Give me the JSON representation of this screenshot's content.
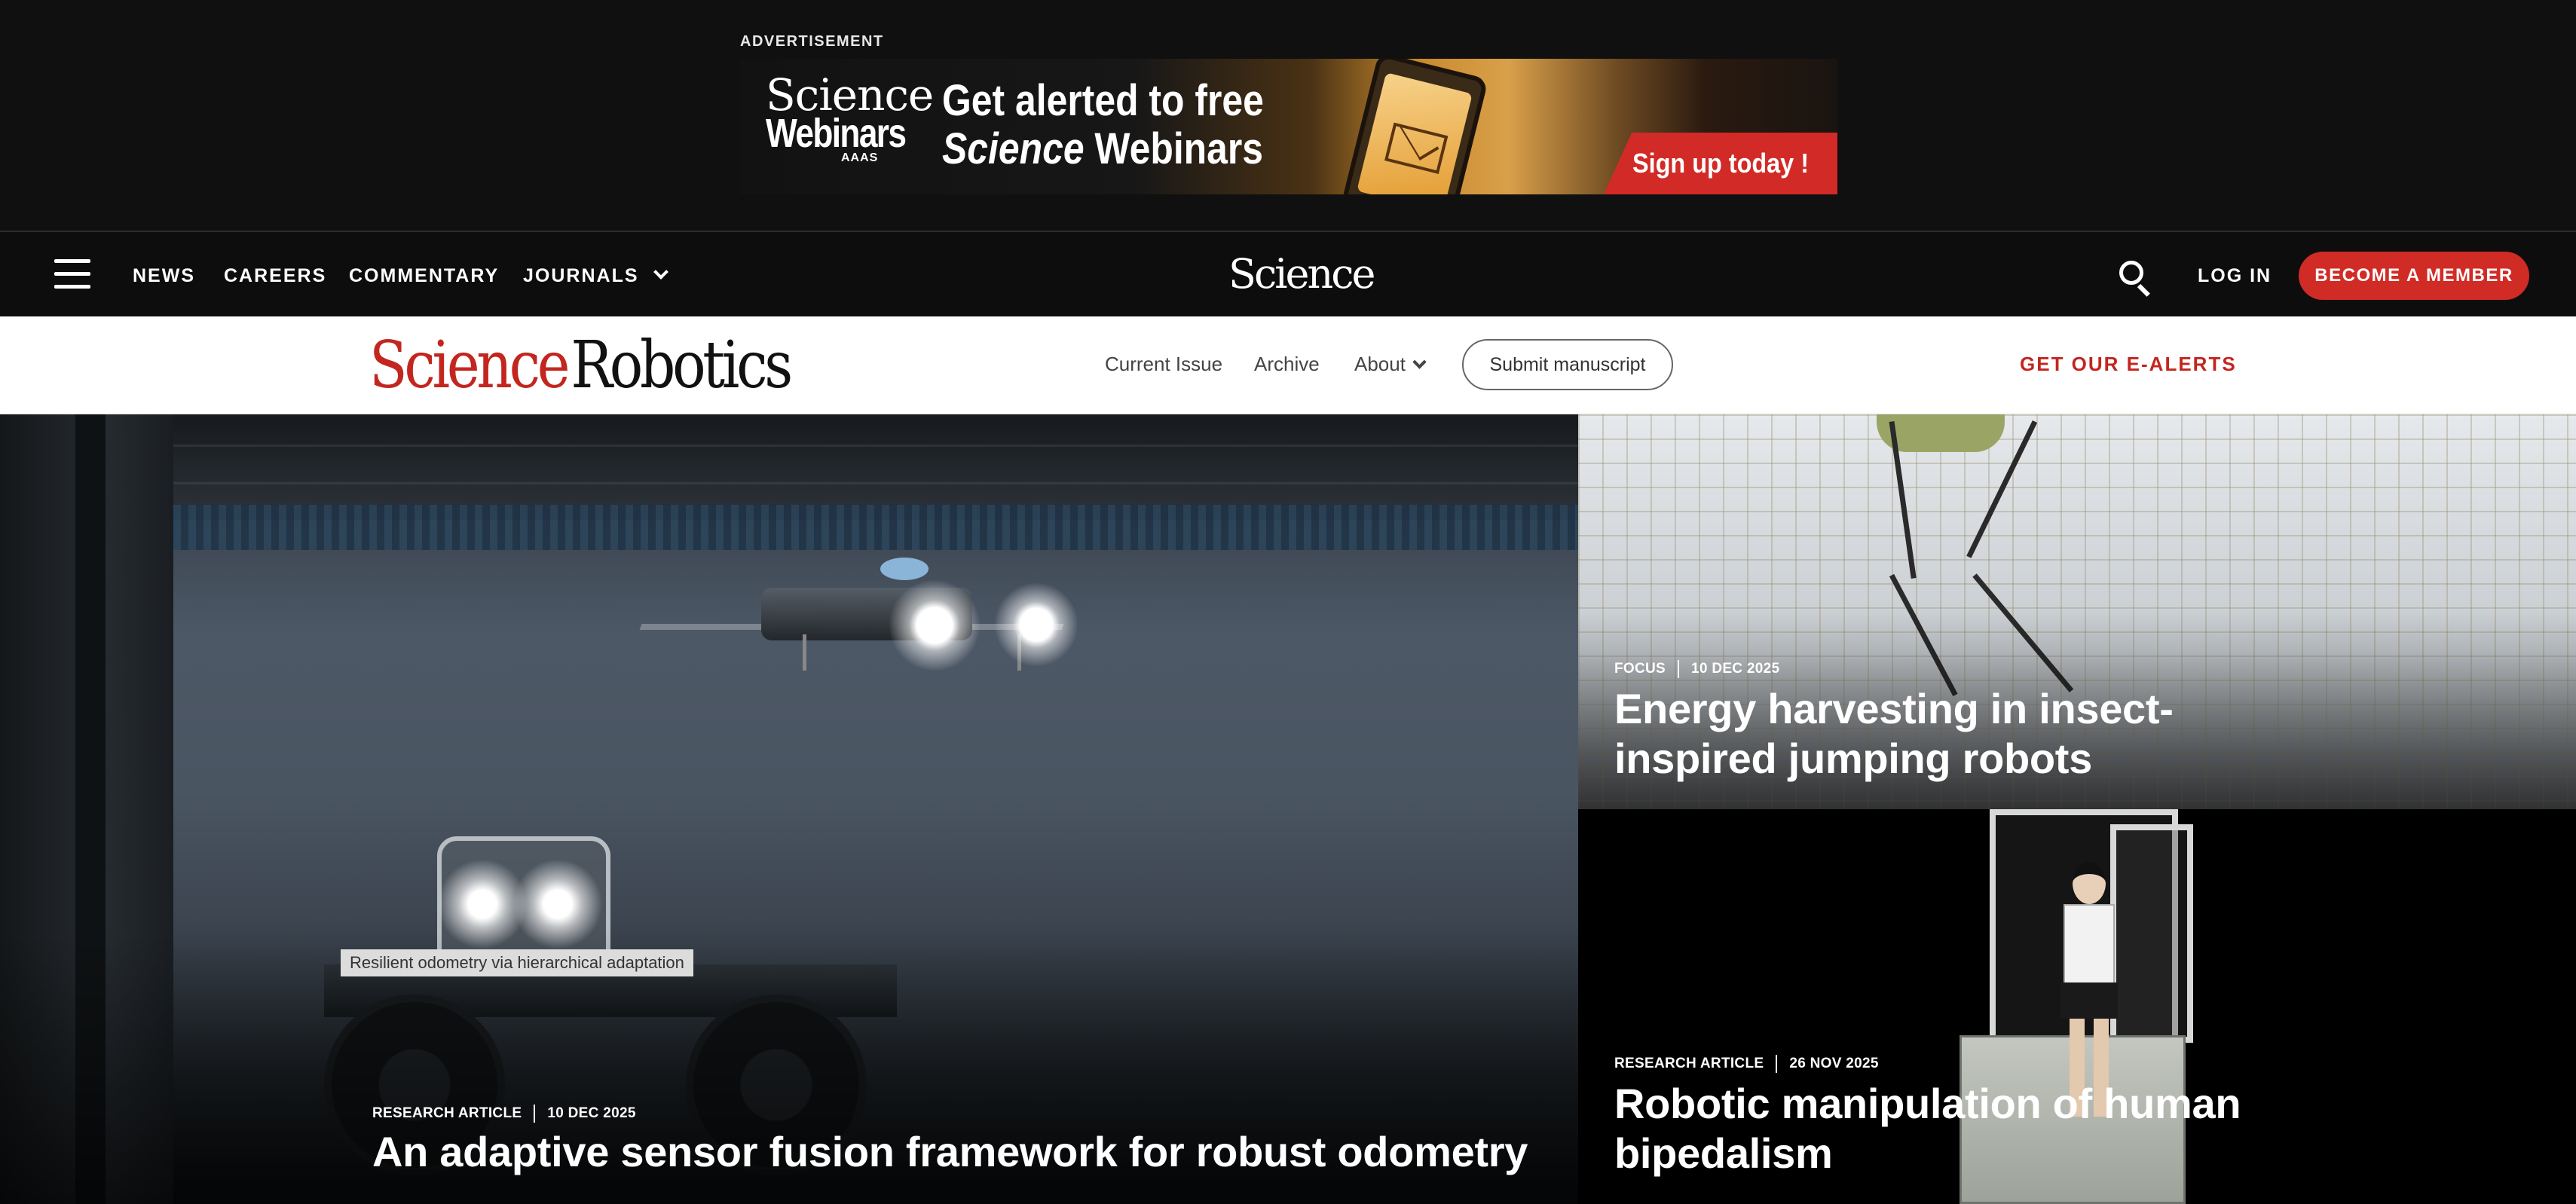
{
  "ad": {
    "label": "ADVERTISEMENT",
    "logo_line1": "Science",
    "logo_line2": "Webinars",
    "logo_line3": "AAAS",
    "headline_line1": "Get alerted to free",
    "headline_line2_italic": "Science",
    "headline_line2_rest": " Webinars",
    "cta": "Sign up today !"
  },
  "global_nav": {
    "menu_icon": "hamburger-menu-icon",
    "links": [
      "NEWS",
      "CAREERS",
      "COMMENTARY",
      "JOURNALS"
    ],
    "logo": "Science",
    "search_icon": "search-icon",
    "login": "LOG IN",
    "member_button": "BECOME A MEMBER"
  },
  "journal_bar": {
    "logo_science": "Science",
    "logo_journal": "Robotics",
    "links": [
      "Current Issue",
      "Archive",
      "About"
    ],
    "submit": "Submit manuscript",
    "alerts": "GET OUR E-ALERTS"
  },
  "hero": {
    "caption": "Resilient odometry via hierarchical adaptation",
    "type": "RESEARCH ARTICLE",
    "date": "10 DEC 2025",
    "title": "An adaptive sensor fusion framework for robust odometry"
  },
  "card_top": {
    "type": "FOCUS",
    "date": "10 DEC 2025",
    "title_line1": "Energy harvesting in insect-",
    "title_line2": "inspired jumping robots"
  },
  "card_bottom": {
    "type": "RESEARCH ARTICLE",
    "date": "26 NOV 2025",
    "title_line1": "Robotic manipulation of human",
    "title_line2": "bipedalism"
  },
  "colors": {
    "accent_red": "#d12b26",
    "journal_red": "#c2261f",
    "nav_bg": "#0d0d0d"
  }
}
